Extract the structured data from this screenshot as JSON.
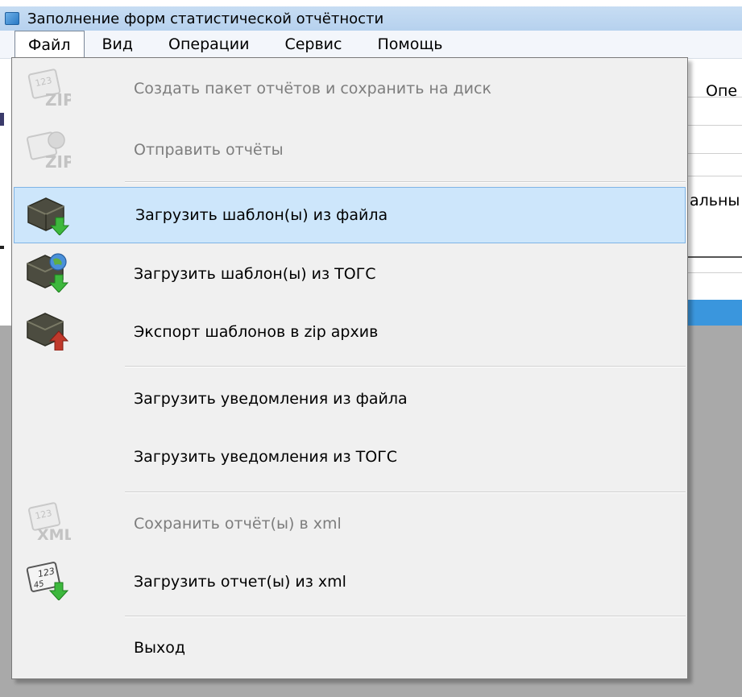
{
  "window": {
    "title": "Заполнение форм статистической отчётности"
  },
  "menubar": {
    "items": [
      {
        "label": "Файл",
        "open": true
      },
      {
        "label": "Вид"
      },
      {
        "label": "Операции"
      },
      {
        "label": "Сервис"
      },
      {
        "label": "Помощь"
      }
    ]
  },
  "background": {
    "text_top": "Опе",
    "text_mid": "альны"
  },
  "file_menu": {
    "items": [
      {
        "label": "Создать пакет отчётов и сохранить на диск",
        "icon": "zip-package-icon",
        "disabled": true
      },
      {
        "label": "Отправить отчёты",
        "icon": "zip-send-icon",
        "disabled": true
      },
      {
        "label": "Загрузить шаблон(ы) из файла",
        "icon": "template-load-file-icon",
        "highlighted": true
      },
      {
        "label": "Загрузить шаблон(ы) из ТОГС",
        "icon": "template-load-togs-icon"
      },
      {
        "label": "Экспорт шаблонов в zip архив",
        "icon": "template-export-icon"
      },
      {
        "label": "Загрузить уведомления из файла"
      },
      {
        "label": "Загрузить уведомления из ТОГС"
      },
      {
        "label": "Сохранить отчёт(ы) в xml",
        "icon": "xml-save-icon",
        "disabled": true
      },
      {
        "label": "Загрузить отчет(ы) из xml",
        "icon": "xml-load-icon"
      },
      {
        "label": "Выход"
      }
    ]
  },
  "colors": {
    "highlight": "#cde6fb",
    "highlight_border": "#7fb4e6",
    "disabled_text": "#7d7d7d",
    "selection_blue": "#3a96dd"
  }
}
